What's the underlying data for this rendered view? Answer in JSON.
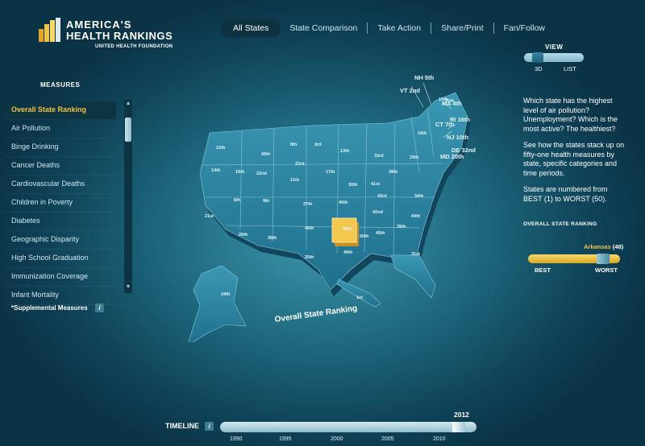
{
  "brand": {
    "title_line1": "AMERICA'S",
    "title_line2": "HEALTH RANKINGS",
    "subtitle": "UNITED HEALTH FOUNDATION"
  },
  "nav": [
    "All States",
    "State Comparison",
    "Take Action",
    "Share/Print",
    "Fan/Follow"
  ],
  "view": {
    "label": "VIEW",
    "opt1": "3D",
    "opt2": "LIST"
  },
  "sidebar": {
    "title": "MEASURES",
    "items": [
      "Overall State Ranking",
      "Air Pollution",
      "Binge Drinking",
      "Cancer Deaths",
      "Cardiovascular Deaths",
      "Children in Poverty",
      "Diabetes",
      "Geographic Disparity",
      "High School Graduation",
      "Immunization Coverage",
      "Infant Mortality"
    ],
    "supplemental": "*Supplemental Measures",
    "info": "i"
  },
  "map": {
    "title": "Overall State Ranking",
    "states": [
      {
        "label": "12th"
      },
      {
        "label": "28th"
      },
      {
        "label": "8th"
      },
      {
        "label": "3rd"
      },
      {
        "label": "14th"
      },
      {
        "label": "19th"
      },
      {
        "label": "22nd"
      },
      {
        "label": "23rd"
      },
      {
        "label": "13th"
      },
      {
        "label": "6th"
      },
      {
        "label": "9th"
      },
      {
        "label": "11th"
      },
      {
        "label": "17th"
      },
      {
        "label": "30th"
      },
      {
        "label": "41st"
      },
      {
        "label": "38th"
      },
      {
        "label": "27th"
      },
      {
        "label": "40th"
      },
      {
        "label": "43rd"
      },
      {
        "label": "46th"
      },
      {
        "label": "34th"
      },
      {
        "label": "21st"
      },
      {
        "label": "26th"
      },
      {
        "label": "36th"
      },
      {
        "label": "25th"
      },
      {
        "label": "48th"
      },
      {
        "label": "42nd"
      },
      {
        "label": "44th"
      },
      {
        "label": "49th"
      },
      {
        "label": "50th"
      },
      {
        "label": "45th"
      },
      {
        "label": "39th"
      },
      {
        "label": "31st"
      },
      {
        "label": "24th"
      },
      {
        "label": "1st"
      },
      {
        "label": "33rd"
      },
      {
        "label": "29th"
      },
      {
        "label": "18th"
      },
      {
        "label": "15th"
      },
      {
        "label": "VT 2nd"
      },
      {
        "label": "NH 5th"
      },
      {
        "label": "MA 4th"
      },
      {
        "label": "CT 7th"
      },
      {
        "label": "RI 16th"
      },
      {
        "label": "NJ 10th"
      },
      {
        "label": "MD 20th"
      },
      {
        "label": "DE 32nd"
      },
      {
        "label": "15th"
      }
    ]
  },
  "description": {
    "p1": "Which state has the highest level of air pollution? Unemployment? Which is the most active? The healthiest?",
    "p2": "See how the states stack up on fifty-one health measures by state, specific categories and time periods.",
    "p3": "States are numbered from BEST (1) to WORST (50)."
  },
  "ranking": {
    "heading": "OVERALL STATE RANKING",
    "state": "Arkansas",
    "rank": "(48)",
    "rank_value": 48,
    "best": "BEST",
    "worst": "WORST"
  },
  "timeline": {
    "label": "TIMELINE",
    "info": "i",
    "selected_year": "2012",
    "ticks": [
      "1990",
      "1995",
      "2000",
      "2005",
      "2010"
    ]
  }
}
